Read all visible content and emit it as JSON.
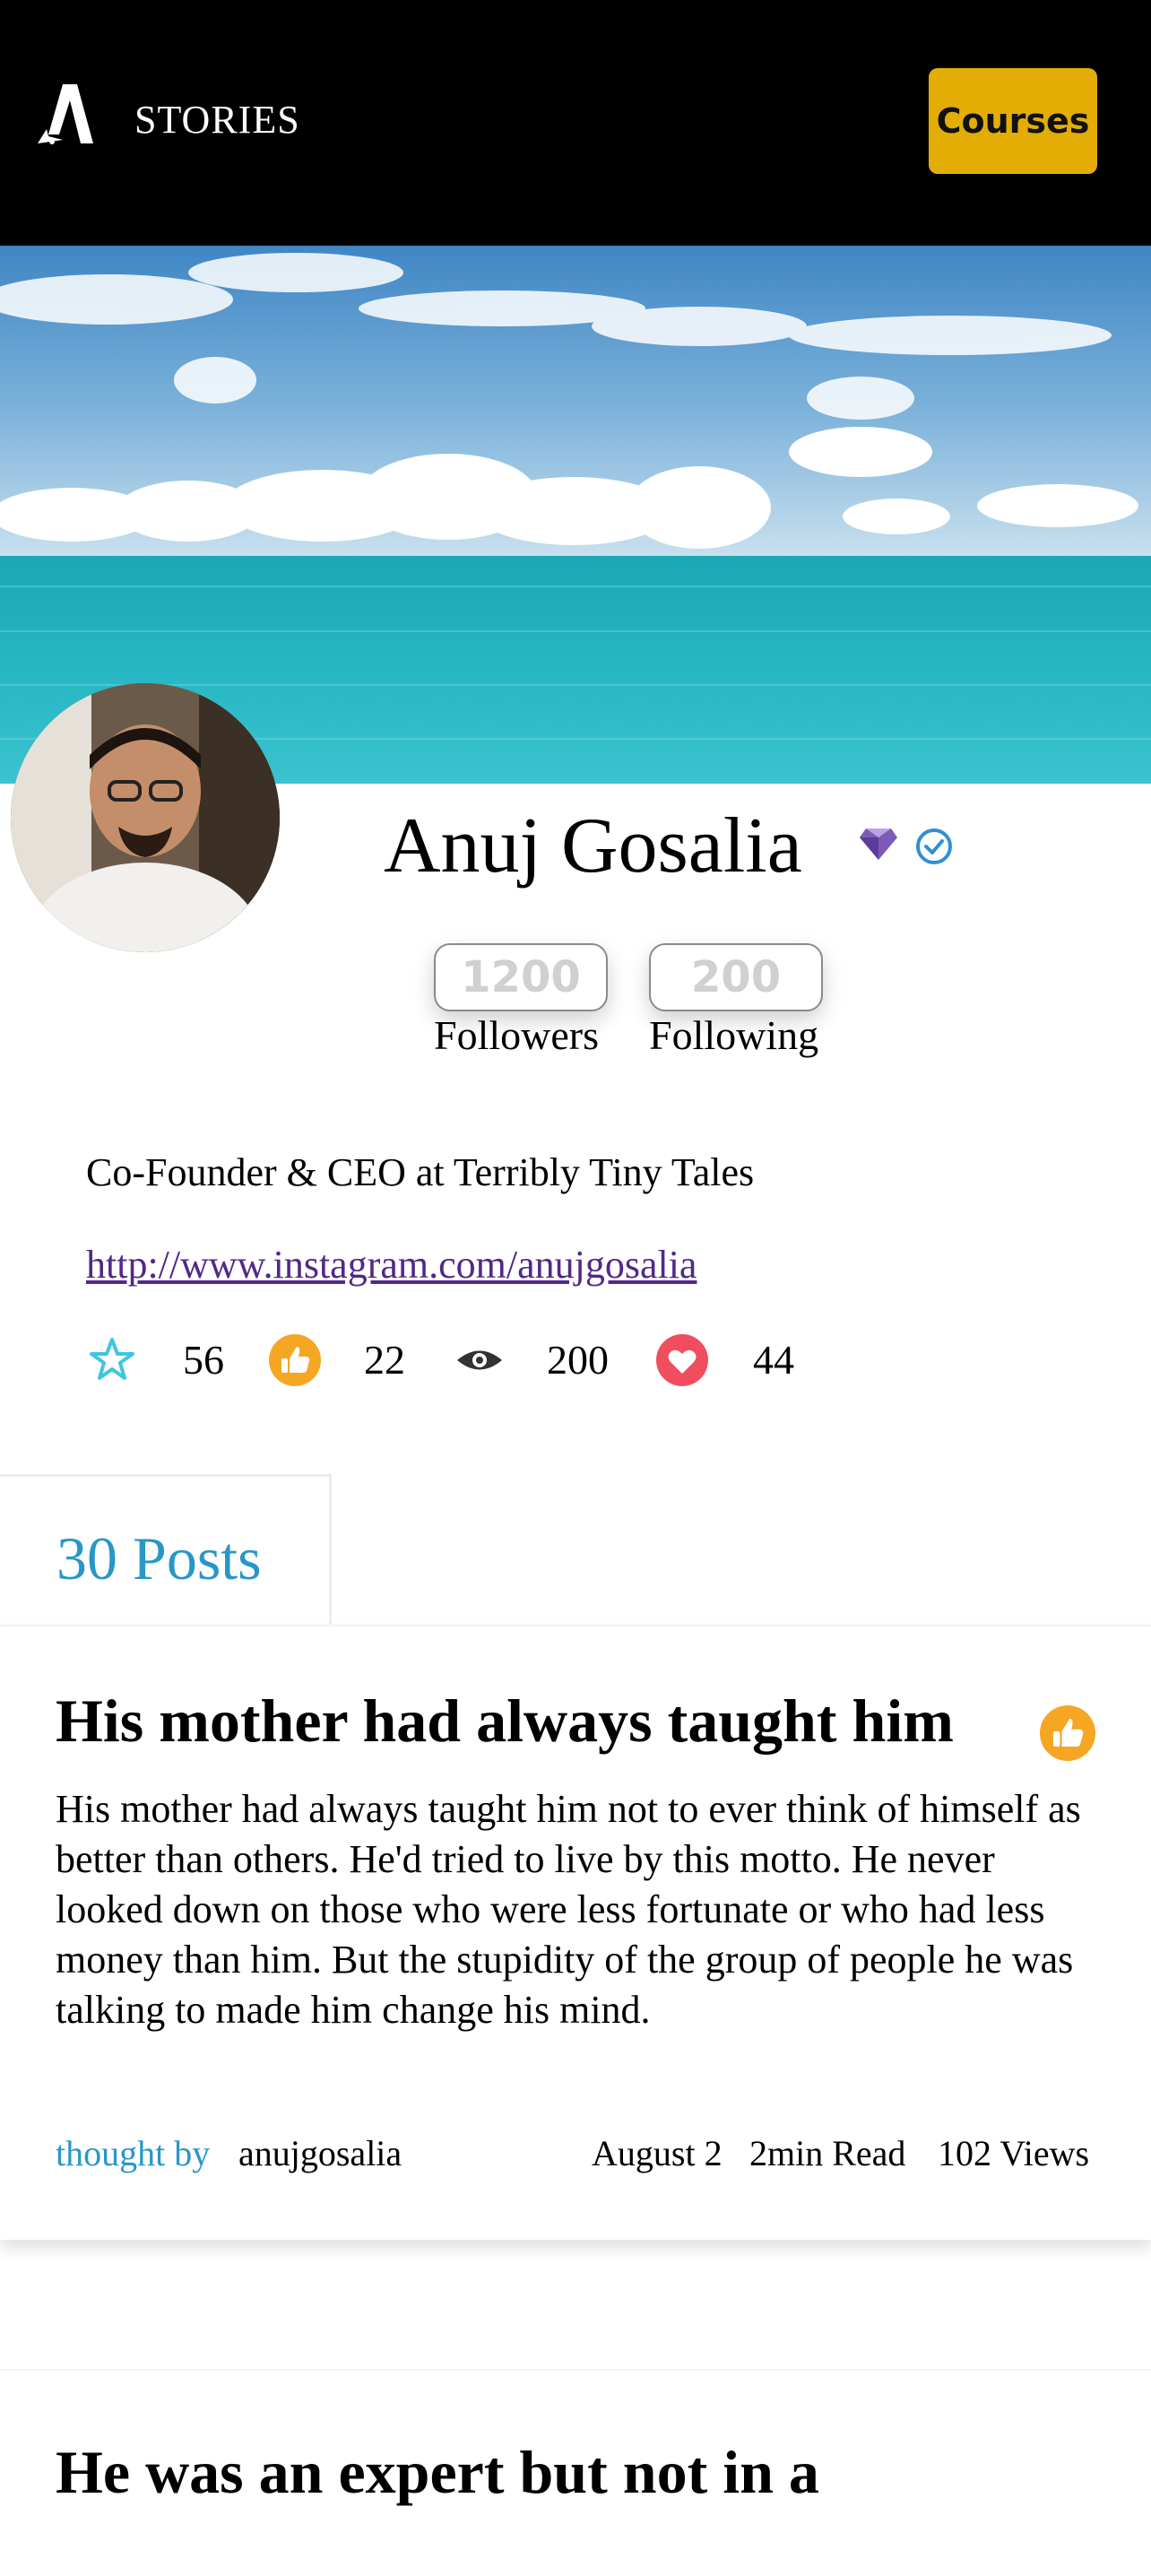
{
  "header": {
    "brand": "STORIES",
    "courses_button": "Courses"
  },
  "profile": {
    "name": "Anuj Gosalia",
    "followers_count": "1200",
    "followers_label": "Followers",
    "following_count": "200",
    "following_label": "Following",
    "bio": "Co-Founder & CEO at Terribly Tiny Tales",
    "link": "http://www.instagram.com/anujgosalia",
    "badges": [
      "diamond-icon",
      "verified-icon"
    ]
  },
  "metrics": [
    {
      "icon": "star-icon",
      "value": "56",
      "color": "#3ec6e0"
    },
    {
      "icon": "thumbs-up-icon",
      "value": "22",
      "color": "#f5a623"
    },
    {
      "icon": "eye-icon",
      "value": "200",
      "color": "#333333"
    },
    {
      "icon": "heart-icon",
      "value": "44",
      "color": "#f04d5e"
    }
  ],
  "posts_tab": {
    "label": "30 Posts"
  },
  "posts": [
    {
      "title": "His mother had always taught him",
      "body": "His mother had always taught him not to ever think of himself as better than others. He'd tried to live by this motto. He never looked down on those who were less fortunate or who had less money than him. But the stupidity of the group of people he was talking to made him change his mind.",
      "thought_by_label": "thought by",
      "author": "anujgosalia",
      "date": "August 2",
      "read_time": "2min Read",
      "views": "102 Views"
    },
    {
      "title": "He was an expert but not in a"
    }
  ],
  "colors": {
    "accent": "#2897c7",
    "courses": "#e3ad05",
    "link": "#52288a"
  }
}
